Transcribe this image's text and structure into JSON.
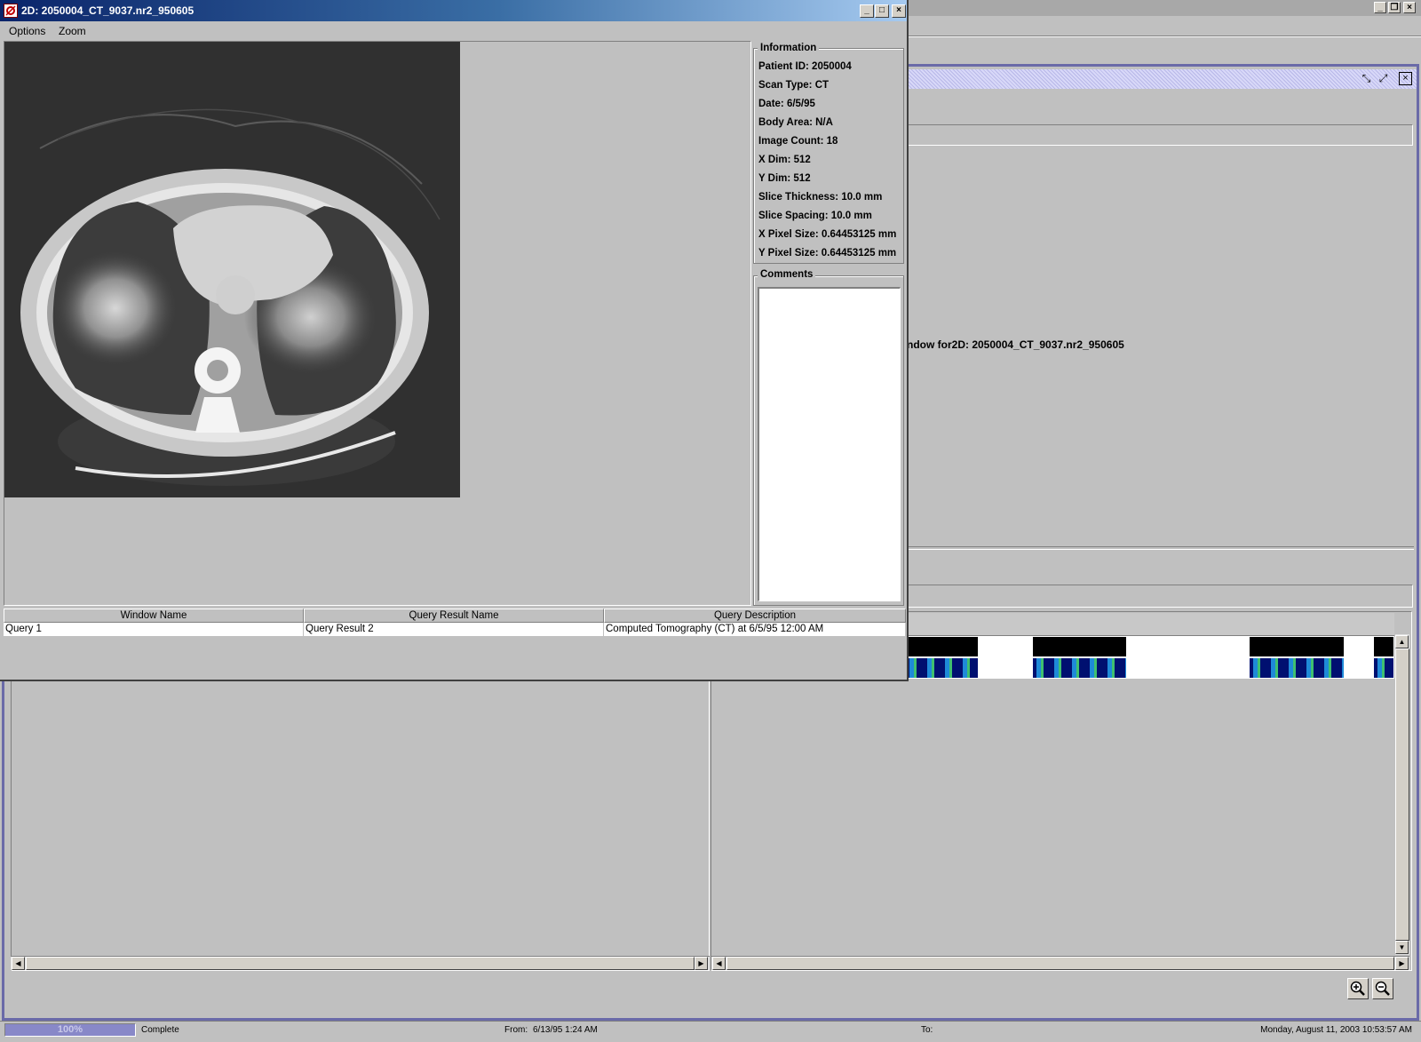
{
  "main_window": {
    "visualization_text": "ndow for2D: 2050004_CT_9037.nr2_950605",
    "status": {
      "progress_percent": 100,
      "progress_label": "100%",
      "status_text": "Complete",
      "from_label": "From:",
      "from_value": "6/13/95 1:24 AM",
      "to_label": "To:",
      "to_value": "",
      "datetime": "Monday, August 11, 2003 10:53:57 AM"
    }
  },
  "window_2d": {
    "title": "2D: 2050004_CT_9037.nr2_950605",
    "menu": [
      "Options",
      "Zoom"
    ],
    "information": {
      "legend": "Information",
      "rows": [
        "Patient ID: 2050004",
        "Scan Type: CT",
        "Date: 6/5/95",
        "Body Area: N/A",
        "Image Count: 18",
        "X Dim: 512",
        "Y Dim: 512",
        "Slice Thickness: 10.0 mm",
        "Slice Spacing: 10.0 mm",
        "X Pixel Size: 0.64453125 mm",
        "Y Pixel Size: 0.64453125 mm"
      ]
    },
    "comments": {
      "legend": "Comments",
      "value": ""
    },
    "table": {
      "columns": [
        "Window Name",
        "Query Result Name",
        "Query Description"
      ],
      "rows": [
        [
          "Query 1",
          "Query Result 2",
          "Computed Tomography (CT) at 6/5/95 12:00 AM"
        ]
      ]
    }
  },
  "icons": [
    "app-icon",
    "minimize-icon",
    "maximize-icon",
    "close-icon",
    "zoom-in-icon",
    "zoom-out-icon"
  ]
}
